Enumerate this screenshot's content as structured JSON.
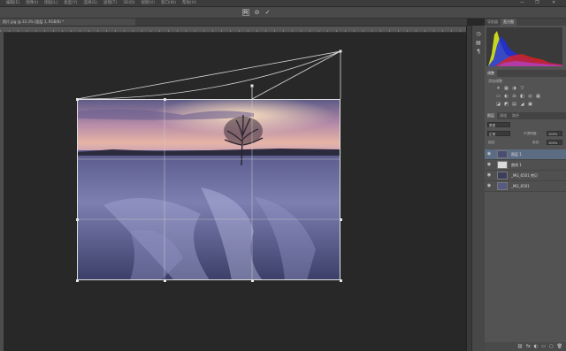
{
  "menu": {
    "items": [
      "编辑(E)",
      "图像(I)",
      "图层(L)",
      "类型(Y)",
      "选择(S)",
      "滤镜(T)",
      "3D(D)",
      "视图(V)",
      "窗口(W)",
      "帮助(H)"
    ],
    "window_controls": [
      "—",
      "❐",
      "✕"
    ]
  },
  "options": {
    "reset_icon": "reset-icon",
    "cancel_symbol": "⊘",
    "commit_symbol": "✓"
  },
  "document": {
    "tab_label": "照片.jpg @ 33.3% (图层 1, RGB/8) *"
  },
  "panels": {
    "top_tabs": [
      "导航器",
      "直方图"
    ],
    "adjustments_tab": "调整",
    "adjustments_label": "添加调整",
    "adjustment_icons_row1": [
      "☀",
      "▦",
      "◑",
      "▽"
    ],
    "adjustment_icons_row2": [
      "▭",
      "◐",
      "⚖",
      "◧",
      "◎",
      "▦"
    ],
    "adjustment_icons_row3": [
      "◪",
      "◩",
      "▤",
      "◢",
      "▣"
    ],
    "layers_tabs": [
      "图层",
      "通道",
      "路径"
    ],
    "filter_label": "类型",
    "blend_mode": "正常",
    "opacity_label": "不透明度:",
    "opacity_value": "100%",
    "lock_label": "锁定:",
    "fill_label": "填充:",
    "fill_value": "100%",
    "layers": [
      {
        "name": "图层 1",
        "selected": true
      },
      {
        "name": "曲线 1",
        "selected": false
      },
      {
        "name": "_MG_6501 拷贝",
        "selected": false
      },
      {
        "name": "_MG_6501",
        "selected": false
      }
    ],
    "layers_footer_icons": [
      "⛓",
      "fx",
      "◐",
      "▭",
      "▢",
      "🗑"
    ]
  },
  "colors": {
    "app_bg": "#282828",
    "panel_bg": "#535353",
    "selected_layer": "#5c6c83",
    "crop_guide": "#dcdcdc"
  }
}
